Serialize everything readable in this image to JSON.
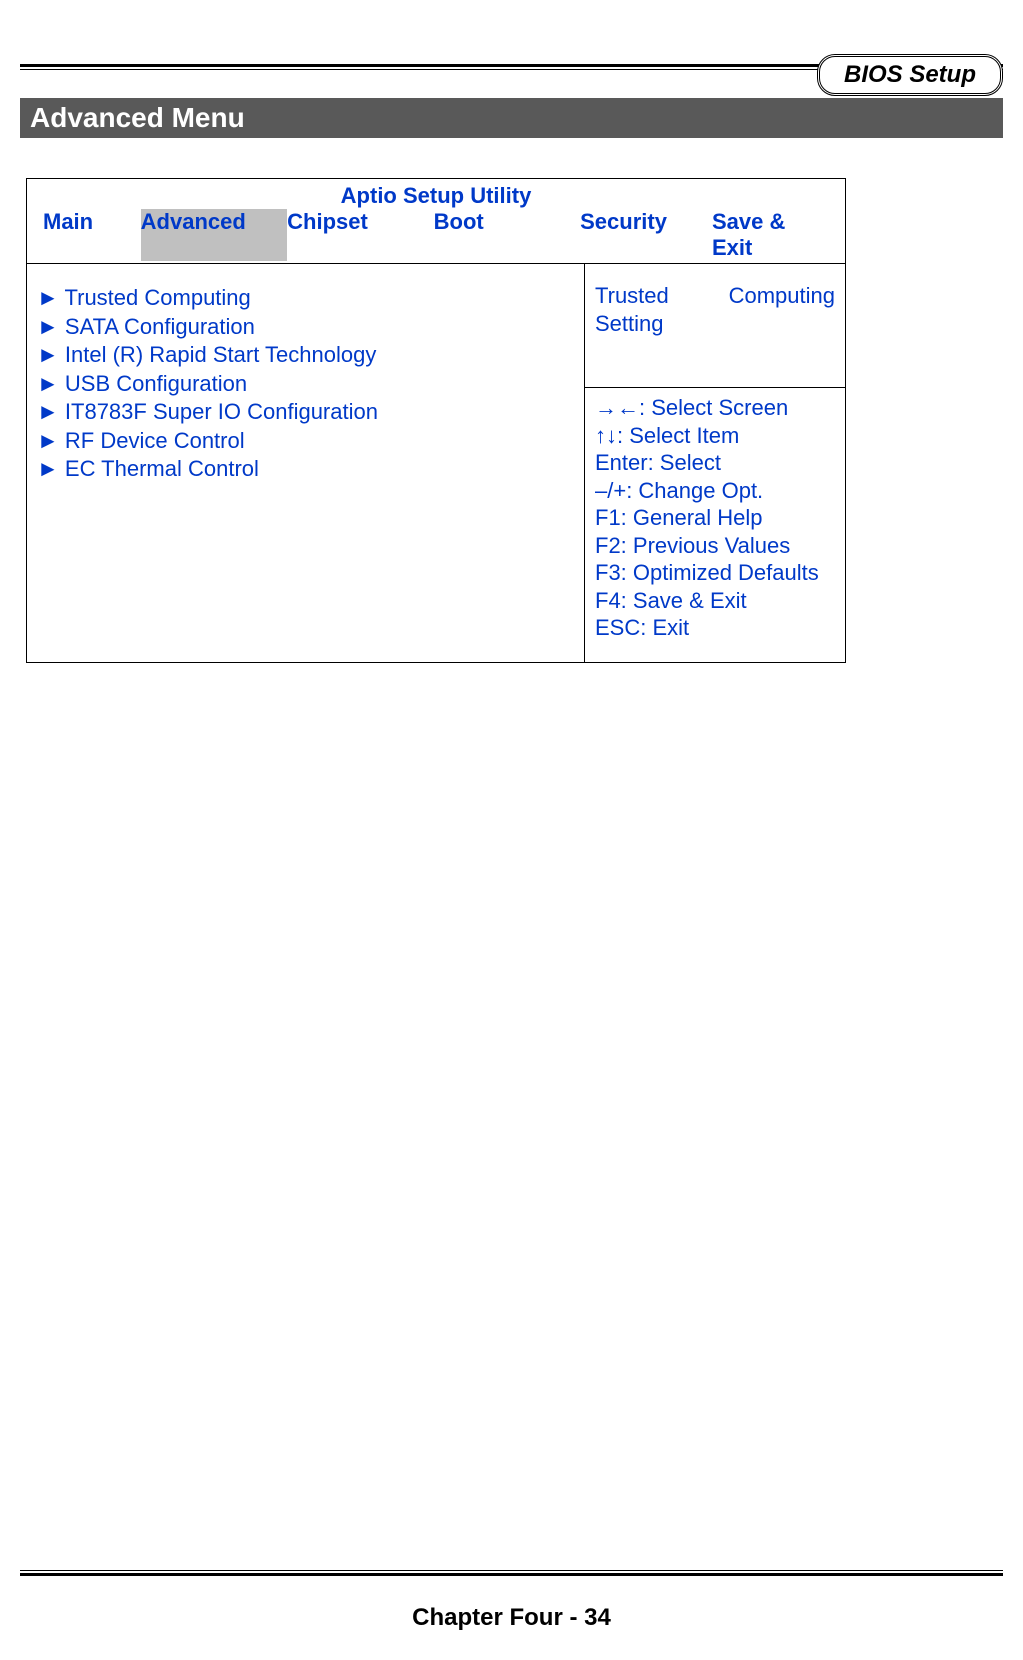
{
  "header": {
    "badge": "BIOS Setup"
  },
  "section": {
    "title": "Advanced Menu"
  },
  "bios": {
    "utility_title": "Aptio Setup Utility",
    "tabs": {
      "main": "Main",
      "advanced": "Advanced",
      "chipset": "Chipset",
      "boot": "Boot",
      "security": "Security",
      "save_exit": "Save & Exit"
    },
    "menu": {
      "arrow": "►",
      "items": [
        "Trusted Computing",
        "SATA Configuration",
        "Intel (R) Rapid Start Technology",
        "USB Configuration",
        "IT8783F Super IO Configuration",
        "RF Device Control",
        "EC Thermal Control"
      ]
    },
    "help": {
      "description": "Trusted Computing Setting"
    },
    "nav": {
      "lines": [
        "→←: Select Screen",
        "↑↓: Select Item",
        "Enter: Select",
        "–/+: Change Opt.",
        "F1: General Help",
        "F2: Previous Values",
        "F3: Optimized Defaults",
        "F4: Save & Exit",
        "ESC: Exit"
      ]
    }
  },
  "footer": {
    "text": "Chapter Four - 34"
  }
}
